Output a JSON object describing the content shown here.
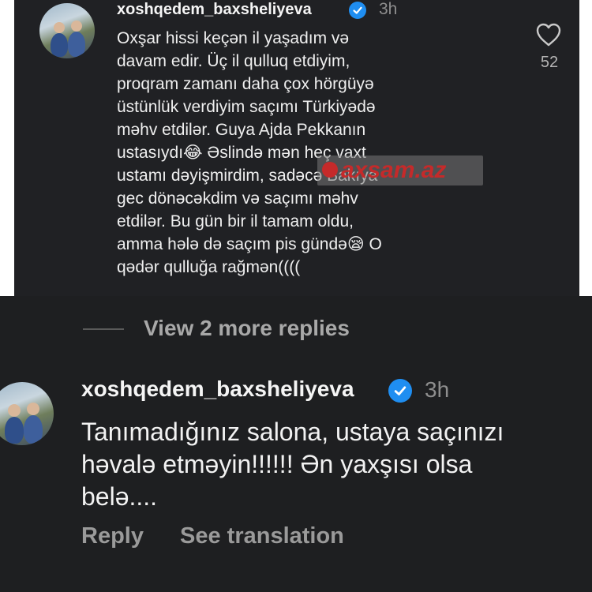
{
  "top_comment": {
    "username": "xoshqedem_baxsheliyeva",
    "time": "3h",
    "lines": [
      "Oxşar hissi keçən il yaşadım və",
      "davam edir. Üç il qulluq etdiyim,",
      "proqram zamanı daha çox hörgüyə",
      "üstünlük verdiyim saçımı Türkiyədə",
      "məhv etdilər. Guya Ajda Pekkanın",
      "ustasıydı😂 Əslində mən heç vaxt",
      "ustamı dəyişmirdim, sadəcə Bakıya",
      "gec dönəcəkdim və saçımı məhv",
      "etdilər. Bu gün bir il tamam oldu,",
      "amma hələ də saçım pis gündə😪 O",
      "qədər qulluğa rağmən(((("
    ],
    "like_count": "52",
    "icons": {
      "like": "heart-icon",
      "verified": "verified-badge-icon"
    }
  },
  "watermark": {
    "text": "axsam.az"
  },
  "view_more_replies": "View 2 more replies",
  "reply_comment": {
    "username": "xoshqedem_baxsheliyeva",
    "time": "3h",
    "lines": [
      "Tanımadığınız salona, ustaya saçınızı",
      "həvalə etməyin!!!!!! Ən yaxşısı olsa",
      "belə...."
    ],
    "reply_label": "Reply",
    "translation_label": "See translation"
  },
  "colors": {
    "background": "#1e1f21",
    "verified": "#1f8ef1",
    "muted": "#9a9a9a"
  }
}
